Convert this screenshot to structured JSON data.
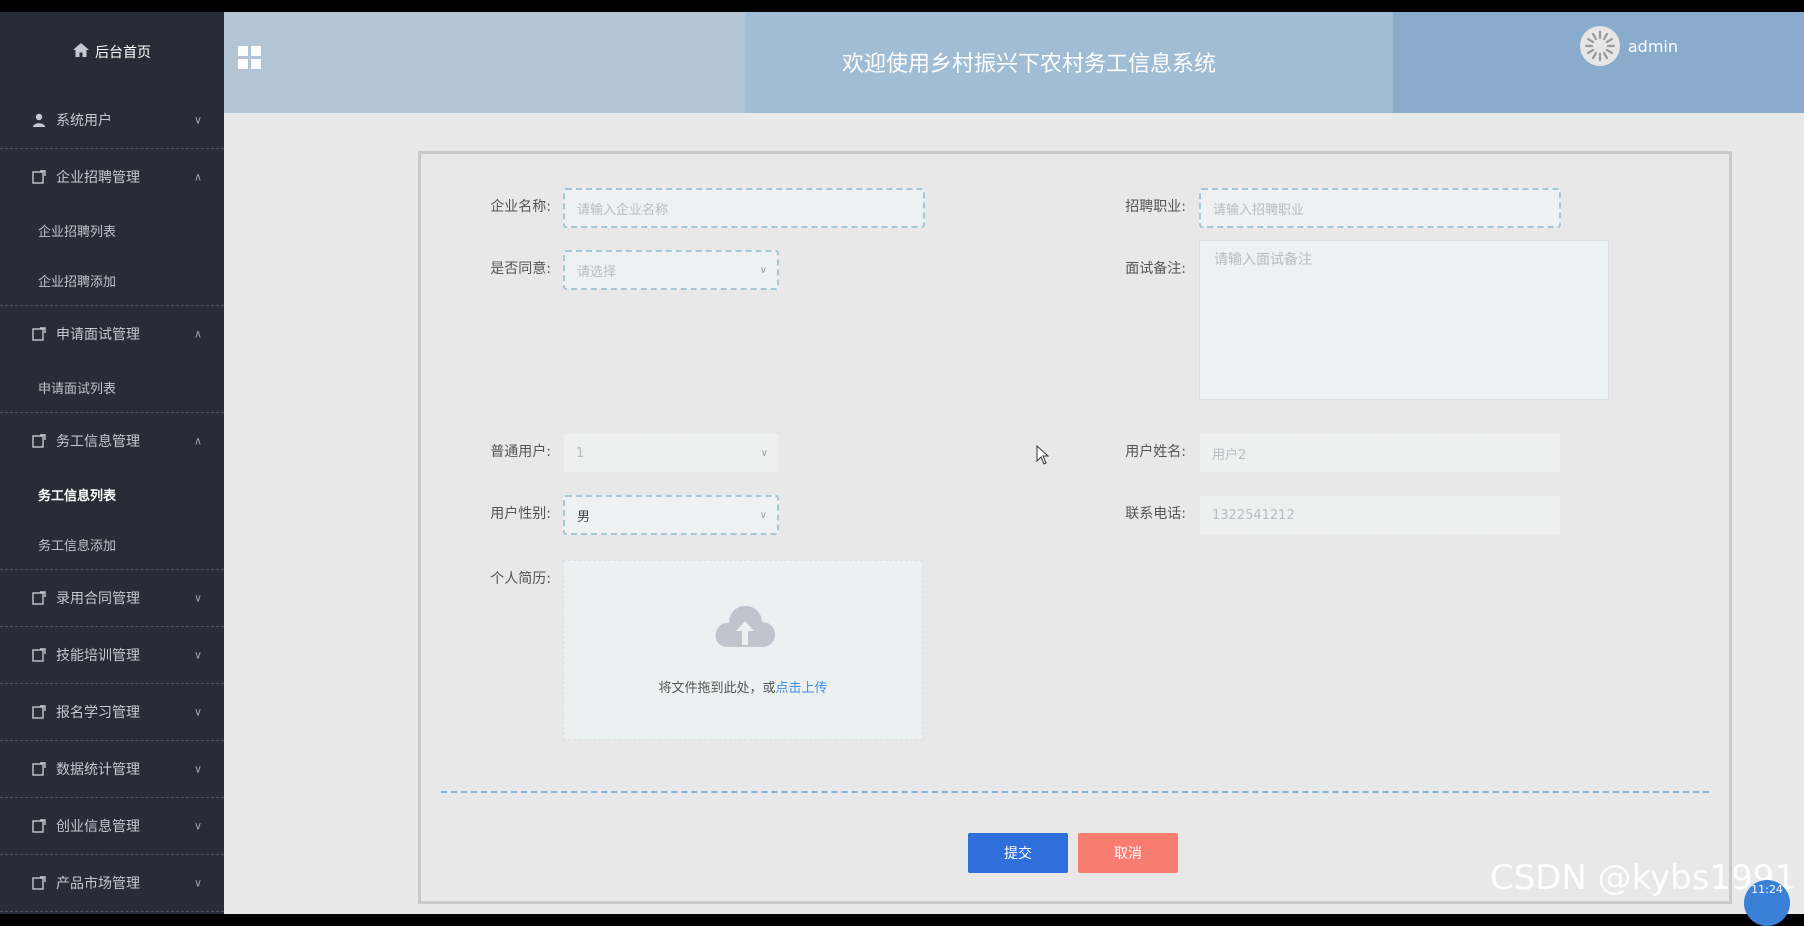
{
  "app": {
    "title": "欢迎使用乡村振兴下农村务工信息系统",
    "user": "admin"
  },
  "sidebar": {
    "home": "后台首页",
    "groups": [
      {
        "label": "系统用户",
        "expanded": false,
        "items": []
      },
      {
        "label": "企业招聘管理",
        "expanded": true,
        "items": [
          "企业招聘列表",
          "企业招聘添加"
        ]
      },
      {
        "label": "申请面试管理",
        "expanded": true,
        "items": [
          "申请面试列表"
        ]
      },
      {
        "label": "务工信息管理",
        "expanded": true,
        "items": [
          "务工信息列表",
          "务工信息添加"
        ]
      },
      {
        "label": "录用合同管理",
        "expanded": false,
        "items": []
      },
      {
        "label": "技能培训管理",
        "expanded": false,
        "items": []
      },
      {
        "label": "报名学习管理",
        "expanded": false,
        "items": []
      },
      {
        "label": "数据统计管理",
        "expanded": false,
        "items": []
      },
      {
        "label": "创业信息管理",
        "expanded": false,
        "items": []
      },
      {
        "label": "产品市场管理",
        "expanded": false,
        "items": []
      }
    ],
    "active": "务工信息列表"
  },
  "form": {
    "company_name": {
      "label": "企业名称:",
      "placeholder": "请输入企业名称"
    },
    "job": {
      "label": "招聘职业:",
      "placeholder": "请输入招聘职业"
    },
    "agree": {
      "label": "是否同意:",
      "placeholder": "请选择"
    },
    "interview_note": {
      "label": "面试备注:",
      "placeholder": "请输入面试备注"
    },
    "normal_user": {
      "label": "普通用户:",
      "value": "1"
    },
    "user_name": {
      "label": "用户姓名:",
      "value": "用户2"
    },
    "gender": {
      "label": "用户性别:",
      "value": "男"
    },
    "phone": {
      "label": "联系电话:",
      "value": "1322541212"
    },
    "resume": {
      "label": "个人简历:",
      "upload_text": "将文件拖到此处，或",
      "upload_link": "点击上传"
    },
    "submit": "提交",
    "cancel": "取消"
  },
  "overlay": {
    "watermark": "CSDN @kybs1991",
    "time": "11:24"
  },
  "colors": {
    "sidebar_bg": "#272c36",
    "primary": "#2f6fdb",
    "danger": "#f67d6f",
    "link": "#3a8ee6"
  }
}
